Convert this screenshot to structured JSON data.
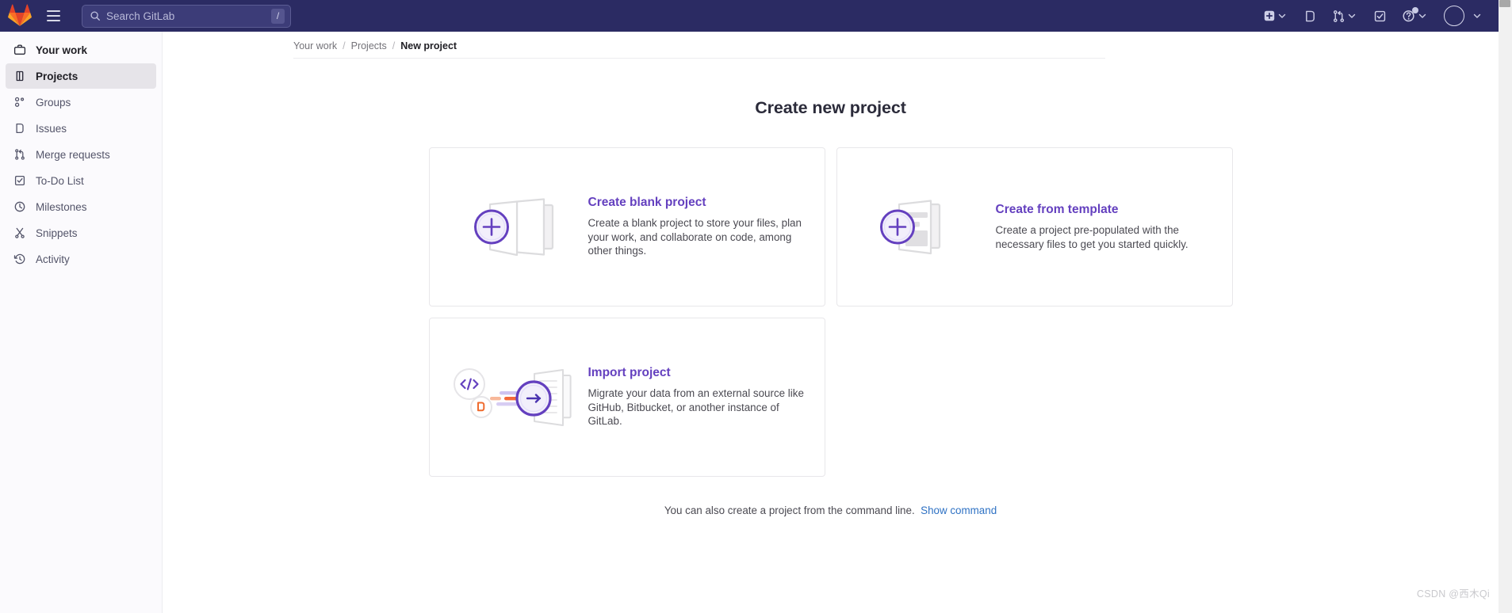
{
  "topbar": {
    "logo_icon": "gitlab-logo-icon",
    "menu_icon": "hamburger-menu-icon",
    "search": {
      "icon": "search-icon",
      "placeholder": "Search GitLab",
      "value": "",
      "shortcut_key": "/"
    },
    "actions": [
      {
        "icon": "create-new-icon",
        "label": "Create new",
        "has_caret": true
      },
      {
        "icon": "issues-icon",
        "label": "Issues",
        "has_caret": false
      },
      {
        "icon": "merge-requests-icon",
        "label": "Merge requests",
        "has_caret": true
      },
      {
        "icon": "todo-list-icon",
        "label": "To-Do List",
        "has_caret": false
      },
      {
        "icon": "help-icon",
        "label": "Help",
        "has_caret": true,
        "has_badge": true
      },
      {
        "icon": "user-avatar-icon",
        "label": "User menu",
        "has_caret": true
      }
    ]
  },
  "sidebar": {
    "header": {
      "label": "Your work",
      "icon": "work-briefcase-icon"
    },
    "items": [
      {
        "label": "Projects",
        "icon": "projects-icon",
        "active": true
      },
      {
        "label": "Groups",
        "icon": "groups-icon",
        "active": false
      },
      {
        "label": "Issues",
        "icon": "issues-icon",
        "active": false
      },
      {
        "label": "Merge requests",
        "icon": "merge-requests-icon",
        "active": false
      },
      {
        "label": "To-Do List",
        "icon": "todo-list-icon",
        "active": false
      },
      {
        "label": "Milestones",
        "icon": "milestones-clock-icon",
        "active": false
      },
      {
        "label": "Snippets",
        "icon": "snippets-scissors-icon",
        "active": false
      },
      {
        "label": "Activity",
        "icon": "activity-history-icon",
        "active": false
      }
    ]
  },
  "breadcrumb": {
    "items": [
      "Your work",
      "Projects",
      "New project"
    ],
    "separator": "/"
  },
  "main": {
    "page_title": "Create new project",
    "cards": [
      {
        "id": "create-blank-project",
        "title": "Create blank project",
        "description": "Create a blank project to store your files, plan your work, and collaborate on code, among other things.",
        "art_icon": "blank-project-plus-icon"
      },
      {
        "id": "create-from-template",
        "title": "Create from template",
        "description": "Create a project pre-populated with the necessary files to get you started quickly.",
        "art_icon": "template-project-plus-icon"
      },
      {
        "id": "import-project",
        "title": "Import project",
        "description": "Migrate your data from an external source like GitHub, Bitbucket, or another instance of GitLab.",
        "art_icon": "import-project-arrow-icon"
      }
    ],
    "cli_note": {
      "text": "You can also create a project from the command line.",
      "link_label": "Show command"
    }
  },
  "watermark": "CSDN @西木Qi",
  "colors": {
    "topbar_bg": "#2b2b63",
    "sidebar_bg": "#fbfafd",
    "accent_purple": "#6440bf",
    "link_blue": "#2f72c4",
    "card_border": "#e8e7ea",
    "text_primary": "#1f1e24",
    "text_muted": "#737278"
  }
}
